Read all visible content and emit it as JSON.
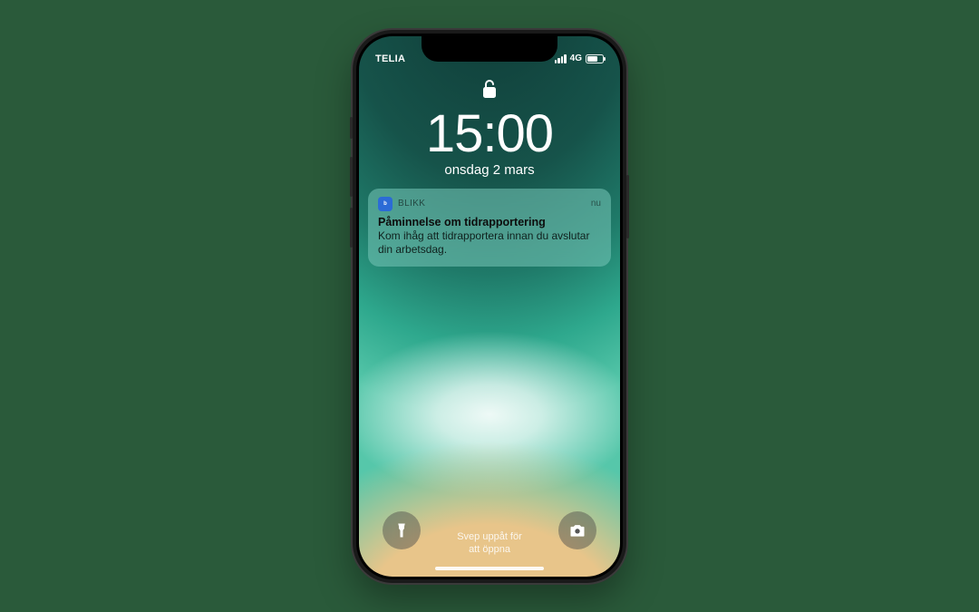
{
  "status": {
    "carrier": "TELIA",
    "network": "4G"
  },
  "lock": {
    "time": "15:00",
    "date": "onsdag 2 mars"
  },
  "notification": {
    "app_name": "BLIKK",
    "when": "nu",
    "title": "Påminnelse om tidrapportering",
    "body": "Kom ihåg att tidrapportera innan du avslutar din arbetsdag."
  },
  "hint": {
    "line1": "Svep uppåt för",
    "line2": "att öppna"
  }
}
